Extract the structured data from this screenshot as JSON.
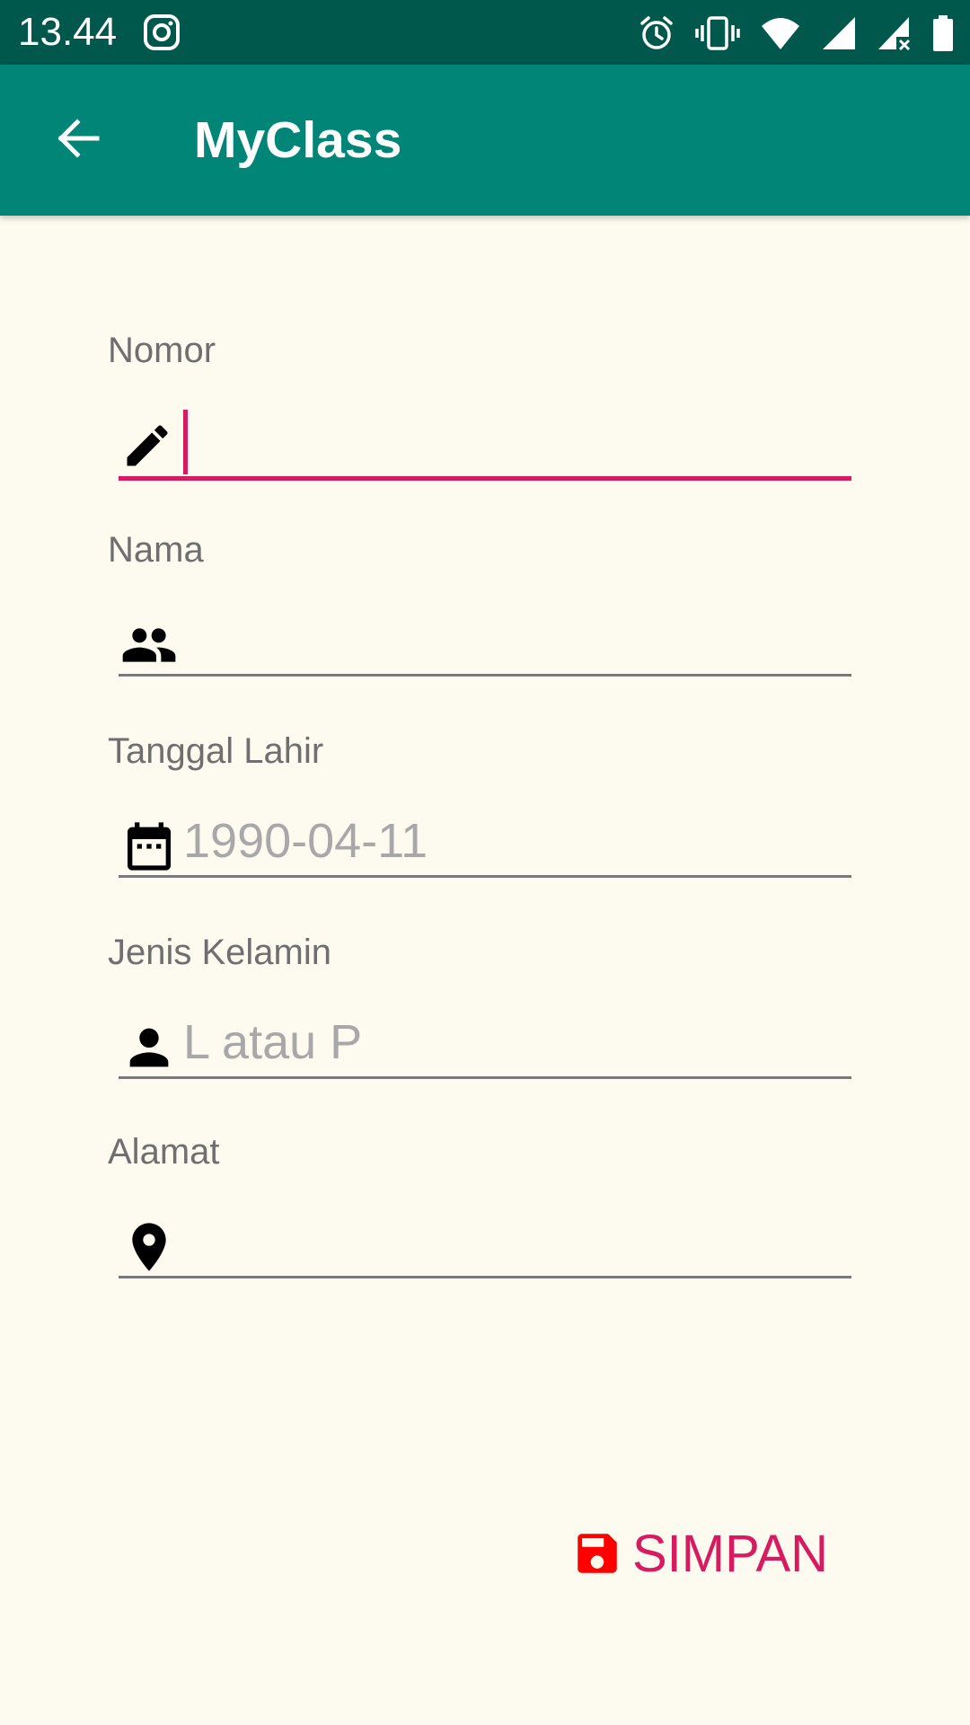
{
  "status_bar": {
    "time": "13.44",
    "left_icon": "instagram-icon",
    "right_icons": [
      "alarm-icon",
      "vibrate-icon",
      "wifi-icon",
      "signal-icon",
      "signal-no-data-icon",
      "battery-icon"
    ]
  },
  "app_bar": {
    "title": "MyClass",
    "back_icon": "arrow-back-icon"
  },
  "form": {
    "fields": [
      {
        "label": "Nomor",
        "icon": "pencil-icon",
        "value": "",
        "placeholder": "",
        "focused": true
      },
      {
        "label": "Nama",
        "icon": "people-icon",
        "value": "",
        "placeholder": ""
      },
      {
        "label": "Tanggal Lahir",
        "icon": "calendar-icon",
        "value": "",
        "placeholder": "1990-04-11"
      },
      {
        "label": "Jenis Kelamin",
        "icon": "person-icon",
        "value": "",
        "placeholder": "L atau P"
      },
      {
        "label": "Alamat",
        "icon": "location-pin-icon",
        "value": "",
        "placeholder": ""
      }
    ]
  },
  "actions": {
    "save_label": "SIMPAN",
    "save_icon": "floppy-disk-icon"
  },
  "colors": {
    "status_bar": "#00574b",
    "app_bar": "#008577",
    "accent": "#d81b60",
    "save_icon": "#ff0000",
    "background": "#fdfaf0"
  }
}
